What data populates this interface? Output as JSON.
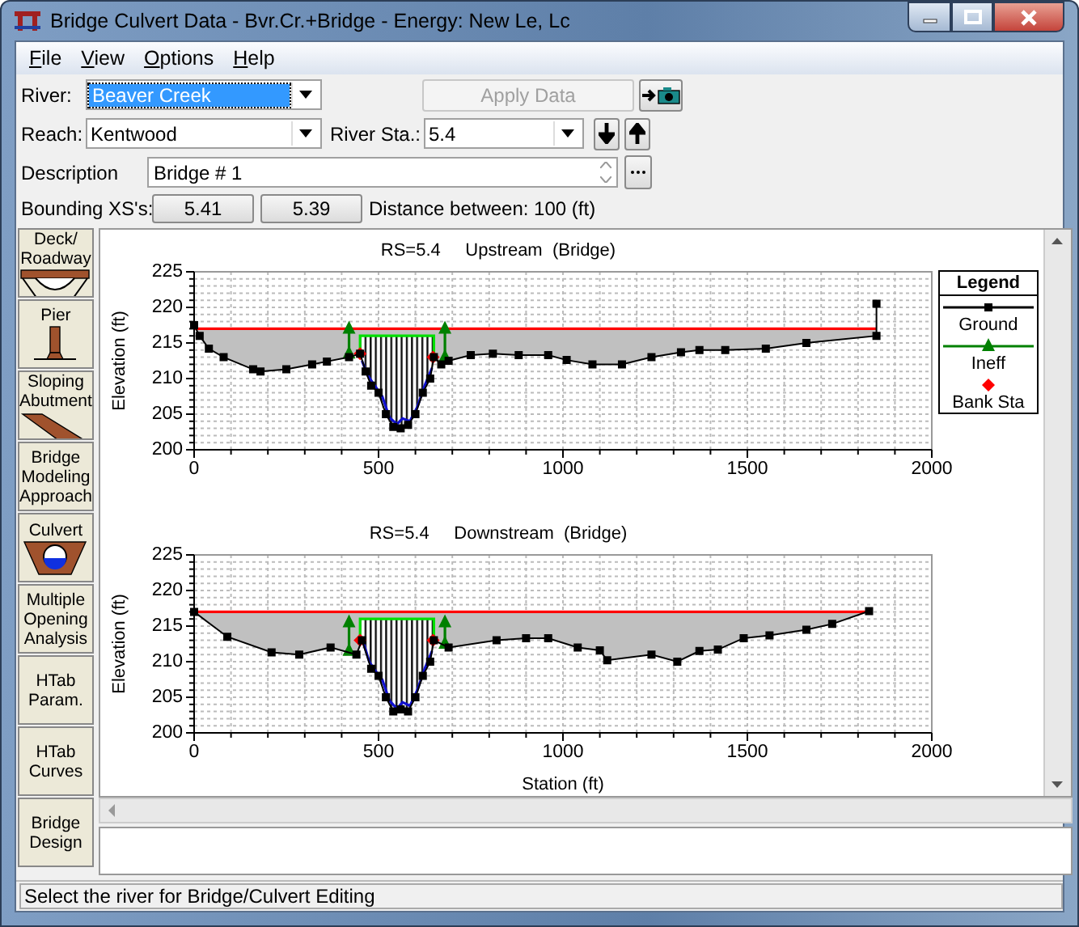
{
  "window": {
    "title": "Bridge Culvert Data - Bvr.Cr.+Bridge - Energy: New Le, Lc"
  },
  "menu": [
    {
      "label": "File"
    },
    {
      "label": "View"
    },
    {
      "label": "Options"
    },
    {
      "label": "Help"
    }
  ],
  "river": {
    "label": "River:",
    "value": "Beaver Creek",
    "focused": true
  },
  "apply_button": {
    "label": "Apply Data",
    "disabled": true
  },
  "reach": {
    "label": "Reach:",
    "value": "Kentwood"
  },
  "river_station": {
    "label": "River Sta.:",
    "value": "5.4"
  },
  "description": {
    "label": "Description",
    "value": "Bridge # 1"
  },
  "bounding": {
    "label": "Bounding XS's:",
    "buttons": [
      "5.41",
      "5.39"
    ],
    "distance": "Distance between: 100 (ft)"
  },
  "editors": [
    {
      "label": "Deck/\nRoadway",
      "kind": "deck"
    },
    {
      "label": "Pier",
      "kind": "pier"
    },
    {
      "label": "Sloping\nAbutment",
      "kind": "abutment"
    },
    {
      "label": "Bridge\nModeling\nApproach",
      "kind": "text"
    },
    {
      "label": "Culvert",
      "kind": "culvert"
    },
    {
      "label": "Multiple\nOpening\nAnalysis",
      "kind": "text"
    },
    {
      "label": "HTab\nParam.",
      "kind": "text"
    },
    {
      "label": "HTab\nCurves",
      "kind": "text"
    },
    {
      "label": "Bridge\nDesign",
      "kind": "text"
    }
  ],
  "plots": [
    {
      "chart_data": {
        "type": "line",
        "title": "RS=5.4     Upstream  (Bridge)",
        "ylabel": "Elevation (ft)",
        "xlim": [
          0,
          2000
        ],
        "ylim": [
          200,
          225
        ],
        "xticks": [
          0,
          500,
          1000,
          1500,
          2000
        ],
        "yticks": [
          200,
          205,
          210,
          215,
          220,
          225
        ],
        "grid": true,
        "legend": {
          "title": "Legend"
        },
        "series": [
          {
            "name": "Ground",
            "color": "#000000",
            "marker": "square",
            "x": [
              0,
              15,
              40,
              80,
              160,
              180,
              250,
              320,
              360,
              420,
              450,
              465,
              480,
              500,
              520,
              540,
              560,
              580,
              600,
              620,
              640,
              650,
              670,
              690,
              750,
              810,
              880,
              960,
              1010,
              1080,
              1160,
              1240,
              1320,
              1370,
              1440,
              1550,
              1660,
              1850,
              1850
            ],
            "values": [
              217.5,
              216,
              214.2,
              213,
              211.3,
              211,
              211.3,
              212,
              212.4,
              213,
              213.5,
              211,
              209,
              208,
              205,
              203.2,
              203,
              203.5,
              205,
              208,
              210,
              213,
              212,
              212.5,
              213.3,
              213.5,
              213.3,
              213.3,
              212.6,
              212,
              212,
              213,
              213.7,
              214,
              214,
              214.2,
              215,
              216,
              220.5
            ]
          },
          {
            "name": "Ineff",
            "color": "#008000",
            "marker": "triangle",
            "x": [
              420,
              420,
              null,
              680,
              680
            ],
            "values": [
              213.5,
              217,
              null,
              213,
              217
            ]
          },
          {
            "name": "Bank Sta",
            "color": "#ff0000",
            "marker": "diamond",
            "x": [
              450,
              null,
              648
            ],
            "values": [
              213.5,
              null,
              213
            ]
          },
          {
            "color": "#ff0000",
            "x": [
              0,
              1850
            ],
            "values": [
              217,
              217
            ]
          },
          {
            "color": "#00e000",
            "x": [
              450,
              450,
              650,
              650
            ],
            "values": [
              213.5,
              216,
              216,
              213
            ]
          },
          {
            "color": "#1010d0",
            "x": [
              455,
              470,
              490,
              510,
              530,
              550,
              565,
              585,
              605,
              625,
              645
            ],
            "values": [
              212.5,
              210.5,
              209,
              207.5,
              204.5,
              203.6,
              204.4,
              204,
              206,
              209,
              211.5
            ]
          }
        ]
      }
    },
    {
      "chart_data": {
        "type": "line",
        "title": "RS=5.4     Downstream  (Bridge)",
        "xlabel": "Station (ft)",
        "ylabel": "Elevation (ft)",
        "xlim": [
          0,
          2000
        ],
        "ylim": [
          200,
          225
        ],
        "xticks": [
          0,
          500,
          1000,
          1500,
          2000
        ],
        "yticks": [
          200,
          205,
          210,
          215,
          220,
          225
        ],
        "grid": true,
        "series": [
          {
            "color": "#000000",
            "marker": "square",
            "x": [
              0,
              90,
              210,
              285,
              370,
              440,
              455,
              480,
              500,
              520,
              540,
              560,
              580,
              600,
              620,
              640,
              650,
              690,
              820,
              900,
              960,
              1040,
              1100,
              1120,
              1240,
              1310,
              1370,
              1420,
              1490,
              1560,
              1660,
              1730,
              1830
            ],
            "values": [
              217,
              213.5,
              211.3,
              211,
              212,
              211,
              213,
              209,
              208,
              205,
              203,
              203.3,
              203,
              205,
              208,
              210,
              213,
              212,
              213,
              213.3,
              213.3,
              212,
              211.6,
              210.2,
              211,
              210,
              211.5,
              211.7,
              213.3,
              213.7,
              214.5,
              215.3,
              217.1
            ]
          },
          {
            "color": "#008000",
            "marker": "triangle",
            "x": [
              420,
              420,
              null,
              680,
              680
            ],
            "values": [
              211.5,
              215.5,
              null,
              212.5,
              215.5
            ]
          },
          {
            "color": "#ff0000",
            "marker": "diamond",
            "x": [
              450,
              null,
              648
            ],
            "values": [
              213,
              null,
              213
            ]
          },
          {
            "color": "#ff0000",
            "x": [
              0,
              1830
            ],
            "values": [
              217,
              217
            ]
          },
          {
            "color": "#00e000",
            "x": [
              450,
              450,
              650,
              650
            ],
            "values": [
              213,
              216,
              216,
              213
            ]
          },
          {
            "color": "#1010d0",
            "x": [
              460,
              475,
              490,
              510,
              530,
              550,
              565,
              585,
              605,
              625,
              645
            ],
            "values": [
              212.5,
              210,
              208.8,
              207.5,
              204.5,
              203.4,
              204.3,
              203.8,
              206,
              209,
              211.5
            ]
          }
        ]
      }
    }
  ],
  "status_bar": "Select the river for Bridge/Culvert Editing"
}
